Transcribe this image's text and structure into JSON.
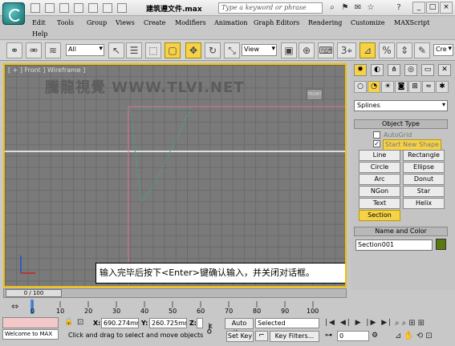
{
  "titlebar": {
    "title": "建筑遵文件.max",
    "search_placeholder": "Type a keyword or phrase"
  },
  "menu": {
    "items": [
      "Edit",
      "Tools",
      "Group",
      "Views",
      "Create",
      "Modifiers",
      "Animation",
      "Graph Editors",
      "Rendering",
      "Customize",
      "MAXScript",
      "Help"
    ]
  },
  "toolbar": {
    "selection_filter": "All",
    "ref_coord": "View",
    "named_selection": "Cre"
  },
  "viewport": {
    "label": "[ + ] Front ] Wireframe ]",
    "watermark": "騰龍視覺 WWW.TLVI.NET",
    "viewcube_label": "FRONT",
    "instruction": "输入完毕后按下<Enter>键确认输入，并关闭对话框。"
  },
  "command_panel": {
    "category_dropdown": "Splines",
    "object_type_title": "Object Type",
    "autogrid_label": "AutoGrid",
    "start_new_shape_label": "Start New Shape",
    "shape_buttons": [
      "Line",
      "Rectangle",
      "Circle",
      "Ellipse",
      "Arc",
      "Donut",
      "NGon",
      "Star",
      "Text",
      "Helix",
      "Section"
    ],
    "name_color_title": "Name and Color",
    "object_name": "Section001",
    "object_color": "#5a7a10"
  },
  "timeline": {
    "frame_display": "0 / 100",
    "ticks": [
      "0",
      "10",
      "20",
      "30",
      "40",
      "50",
      "60",
      "70",
      "80",
      "90",
      "100"
    ]
  },
  "status": {
    "maxscript_text": "Welcome to MAX",
    "x_label": "X:",
    "x_value": "690.274mr",
    "y_label": "Y:",
    "y_value": "260.725mr",
    "z_label": "Z:",
    "prompt": "Click and drag to select and move objects",
    "auto_key": "Auto Key",
    "set_key": "Set Key",
    "key_mode": "Selected",
    "key_filters": "Key Filters...",
    "current_frame": "0"
  },
  "colors": {
    "active_yellow": "#f6d248",
    "viewport_border": "#f0c000"
  }
}
